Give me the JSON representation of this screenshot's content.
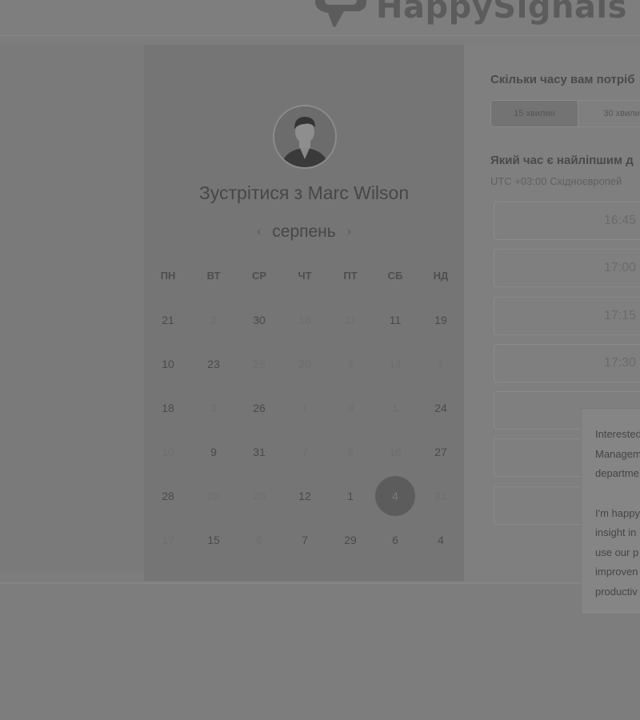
{
  "brand": {
    "name": "HappySignals"
  },
  "calendar": {
    "meeting_title": "Зустрітися з Marc Wilson",
    "month": "серпень",
    "prev_month": "‹",
    "next_month": "›",
    "weekdays": [
      "ПН",
      "ВТ",
      "СР",
      "ЧТ",
      "ПТ",
      "СБ",
      "НД"
    ],
    "weeks": [
      [
        {
          "d": "21",
          "a": true
        },
        {
          "d": "2",
          "a": false
        },
        {
          "d": "30",
          "a": true
        },
        {
          "d": "16",
          "a": false
        },
        {
          "d": "11",
          "a": false
        },
        {
          "d": "11",
          "a": true
        },
        {
          "d": "19",
          "a": true
        }
      ],
      [
        {
          "d": "10",
          "a": true
        },
        {
          "d": "23",
          "a": true
        },
        {
          "d": "25",
          "a": false
        },
        {
          "d": "20",
          "a": false
        },
        {
          "d": "4",
          "a": false
        },
        {
          "d": "14",
          "a": false
        },
        {
          "d": "1",
          "a": false
        }
      ],
      [
        {
          "d": "18",
          "a": true
        },
        {
          "d": "3",
          "a": false
        },
        {
          "d": "26",
          "a": true
        },
        {
          "d": "1",
          "a": false
        },
        {
          "d": "9",
          "a": false
        },
        {
          "d": "1",
          "a": false
        },
        {
          "d": "24",
          "a": true
        }
      ],
      [
        {
          "d": "10",
          "a": false
        },
        {
          "d": "9",
          "a": true
        },
        {
          "d": "31",
          "a": true
        },
        {
          "d": "7",
          "a": false
        },
        {
          "d": "8",
          "a": false
        },
        {
          "d": "16",
          "a": false
        },
        {
          "d": "27",
          "a": true
        }
      ],
      [
        {
          "d": "28",
          "a": true
        },
        {
          "d": "20",
          "a": false
        },
        {
          "d": "20",
          "a": false
        },
        {
          "d": "12",
          "a": true
        },
        {
          "d": "1",
          "a": true
        },
        {
          "d": "4",
          "a": true,
          "sel": true
        },
        {
          "d": "21",
          "a": false
        }
      ],
      [
        {
          "d": "17",
          "a": false
        },
        {
          "d": "15",
          "a": true
        },
        {
          "d": "6",
          "a": false
        },
        {
          "d": "7",
          "a": true
        },
        {
          "d": "29",
          "a": true
        },
        {
          "d": "6",
          "a": true
        },
        {
          "d": "4",
          "a": true
        }
      ]
    ]
  },
  "booking": {
    "duration_question": "Скільки часу вам потріб",
    "durations": [
      "15 хвилин",
      "30 хвили"
    ],
    "time_question": "Який час є найліпшим д",
    "timezone": "UTC +03:00 Східноєвропей",
    "slots": [
      "16:45",
      "17:00",
      "17:15",
      "17:30",
      "",
      "",
      ""
    ]
  },
  "chat_popup": {
    "lines": [
      "Interested",
      "Managem",
      "departme",
      "",
      "I'm happy",
      "insight in",
      "use our p",
      "improven",
      "productiv"
    ]
  },
  "colors": {
    "overlay": "#7d7d7d",
    "panel": "#757575",
    "selected_day": "#5c5c5c"
  }
}
